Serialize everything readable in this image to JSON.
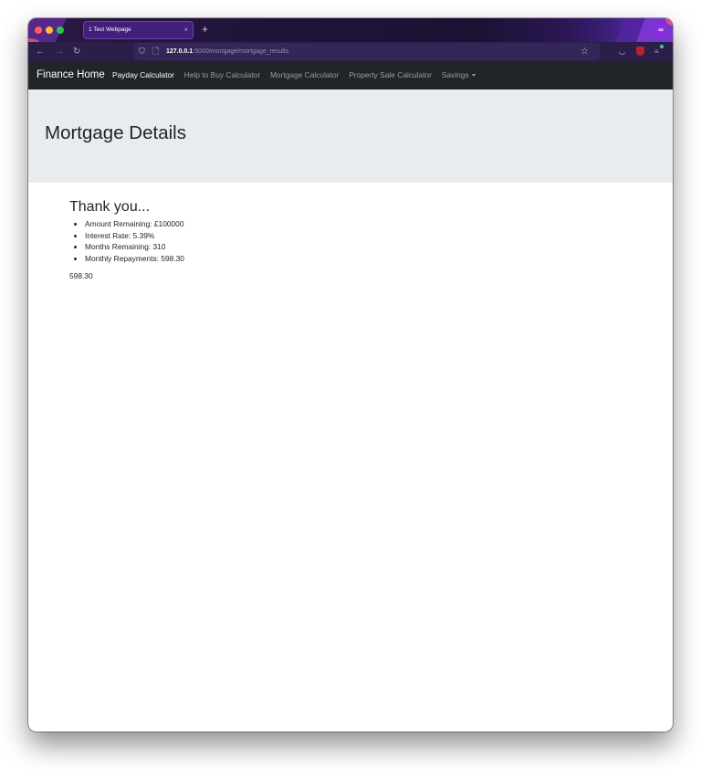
{
  "browser": {
    "tab_title": "1 Test Webpage",
    "tab_close": "×",
    "new_tab": "+",
    "url_host": "127.0.0.1",
    "url_rest": ":5000/mortgage/mortgage_results",
    "icons": {
      "back": "←",
      "forward": "→",
      "reload": "↻",
      "shield": "⛉",
      "page": "🗋",
      "star": "☆",
      "pocket": "◡",
      "menu": "≡",
      "private_mask": "∞"
    }
  },
  "navbar": {
    "brand": "Finance Home",
    "links": [
      {
        "label": "Payday Calculator",
        "active": true
      },
      {
        "label": "Help to Buy Calculator",
        "active": false
      },
      {
        "label": "Mortgage Calculator",
        "active": false
      },
      {
        "label": "Property Sale Calculator",
        "active": false
      },
      {
        "label": "Savings",
        "active": false,
        "dropdown": true
      }
    ]
  },
  "jumbotron": {
    "title": "Mortgage Details"
  },
  "results": {
    "heading": "Thank you...",
    "items": [
      "Amount Remaining: £100000",
      "Interest Rate: 5.39%",
      "Months Remaining: 310",
      "Monthly Repayments: 598.30"
    ],
    "footer_value": "598.30"
  }
}
